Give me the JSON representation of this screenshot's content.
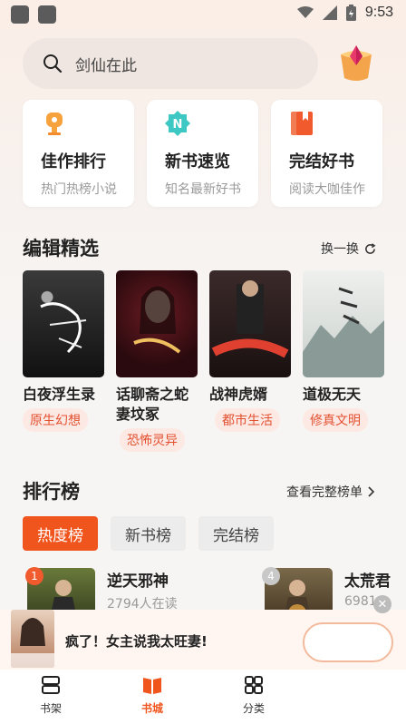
{
  "status_bar": {
    "time": "9:53"
  },
  "search": {
    "placeholder": "剑仙在此"
  },
  "quick_cards": [
    {
      "title": "佳作排行",
      "subtitle": "热门热榜小说"
    },
    {
      "title": "新书速览",
      "subtitle": "知名最新好书"
    },
    {
      "title": "完结好书",
      "subtitle": "阅读大咖佳作"
    }
  ],
  "editor_picks": {
    "title": "编辑精选",
    "action": "换一换",
    "books": [
      {
        "title": "白夜浮生录",
        "tag": "原生幻想"
      },
      {
        "title": "话聊斋之蛇",
        "title2": "妻坟冢",
        "tag": "恐怖灵异"
      },
      {
        "title": "战神虎婿",
        "tag": "都市生活"
      },
      {
        "title": "道极无天",
        "tag": "修真文明"
      }
    ]
  },
  "ranking": {
    "title": "排行榜",
    "action": "查看完整榜单",
    "tabs": [
      "热度榜",
      "新书榜",
      "完结榜"
    ],
    "items": [
      {
        "rank": "1",
        "title": "逆天邪神",
        "sub": "2794人在读"
      },
      {
        "rank": "4",
        "title": "太荒君",
        "sub": "6981"
      }
    ]
  },
  "floating_banner": {
    "text": "疯了！女主说我太旺妻!"
  },
  "bottom_nav": [
    {
      "label": "书架"
    },
    {
      "label": "书城"
    },
    {
      "label": "分类"
    }
  ],
  "colors": {
    "accent": "#f0551e",
    "tag_bg": "#fde9e4",
    "tag_text": "#e2502f"
  }
}
